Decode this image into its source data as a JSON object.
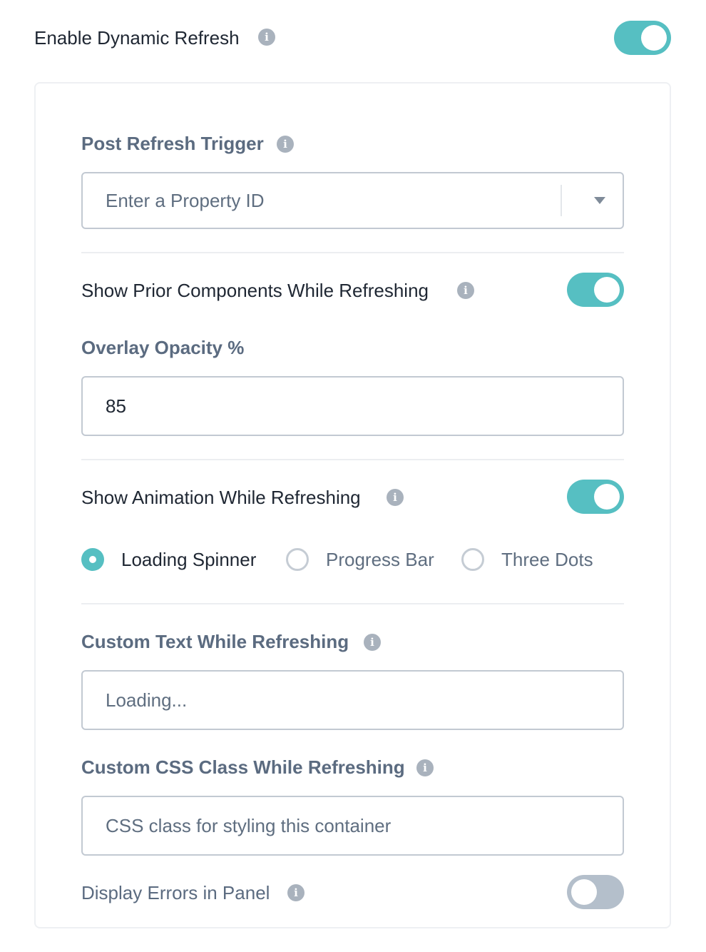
{
  "header": {
    "title": "Enable Dynamic Refresh",
    "enabled": true
  },
  "post_refresh_trigger": {
    "label": "Post Refresh Trigger",
    "placeholder": "Enter a Property ID"
  },
  "show_prior": {
    "label": "Show Prior Components While Refreshing",
    "enabled": true
  },
  "overlay_opacity": {
    "label": "Overlay Opacity %",
    "value": "85"
  },
  "show_animation": {
    "label": "Show Animation While Refreshing",
    "enabled": true,
    "options": [
      {
        "label": "Loading Spinner",
        "selected": true
      },
      {
        "label": "Progress Bar",
        "selected": false
      },
      {
        "label": "Three Dots",
        "selected": false
      }
    ]
  },
  "custom_text": {
    "label": "Custom Text While Refreshing",
    "placeholder": "Loading..."
  },
  "custom_css": {
    "label": "Custom CSS Class While Refreshing",
    "placeholder": "CSS class for styling this container"
  },
  "display_errors": {
    "label": "Display Errors in Panel",
    "enabled": false
  },
  "colors": {
    "accent": "#56bfc2",
    "toggle_off": "#b4bfcb",
    "label_muted": "#5b6b80"
  },
  "icons": {
    "info": "info-icon",
    "dropdown": "caret-down-icon"
  }
}
